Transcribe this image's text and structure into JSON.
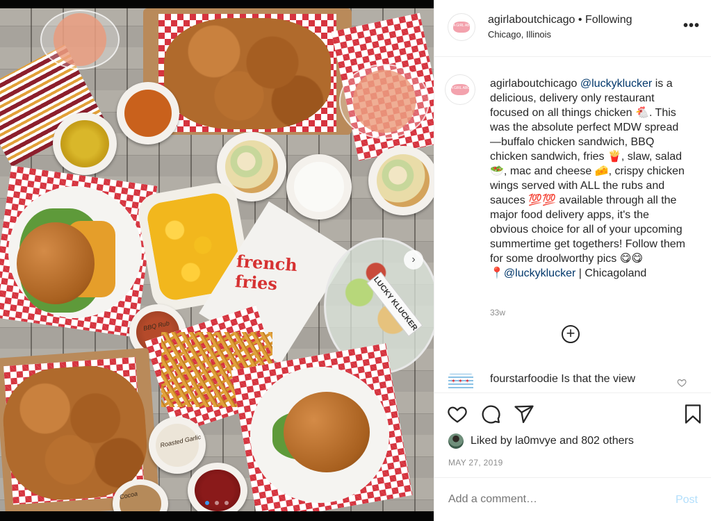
{
  "post": {
    "username": "agirlaboutchicago",
    "separator": "•",
    "follow_status": "Following",
    "location": "Chicago, Illinois",
    "avatar_text": "A GIRL ABOUT CHICAGO",
    "more_icon": "more-options-icon"
  },
  "photo": {
    "bag_text": "french fries",
    "sticker_text": "LUCKY KLUCKER",
    "cup_label_1": "BBQ Rub",
    "cup_label_2": "Roasted Garlic",
    "cup_label_3": "Cocoa",
    "carousel_next": "›",
    "dots": [
      "",
      "",
      ""
    ]
  },
  "caption": {
    "author": "agirlaboutchicago",
    "mention": "@luckyklucker",
    "text1": " is a delicious, delivery only restaurant focused on all things chicken 🐔. This was the absolute perfect MDW spread—buffalo chicken sandwich, BBQ chicken sandwich, fries 🍟, slaw, salad 🥗, mac and cheese 🧀, crispy chicken wings served with ALL the rubs and sauces 💯💯 available through all the major food delivery apps, it's the obvious choice for all of your upcoming summertime get togethers! Follow them for some droolworthy pics 😋😋",
    "pin": "📍",
    "mention2": "@luckyklucker",
    "text2": " | Chicagoland",
    "age": "33w",
    "load_more": "+"
  },
  "comment2": {
    "author": "fourstarfoodie",
    "text": "Is that the view"
  },
  "actions": {
    "like_icon": "heart-icon",
    "comment_icon": "comment-icon",
    "share_icon": "share-icon",
    "save_icon": "bookmark-icon"
  },
  "likes": {
    "prefix": "Liked by ",
    "user": "la0mvye",
    "middle": " and ",
    "others": "802 others"
  },
  "date": "MAY 27, 2019",
  "add_comment": {
    "placeholder": "Add a comment…",
    "post_label": "Post"
  }
}
